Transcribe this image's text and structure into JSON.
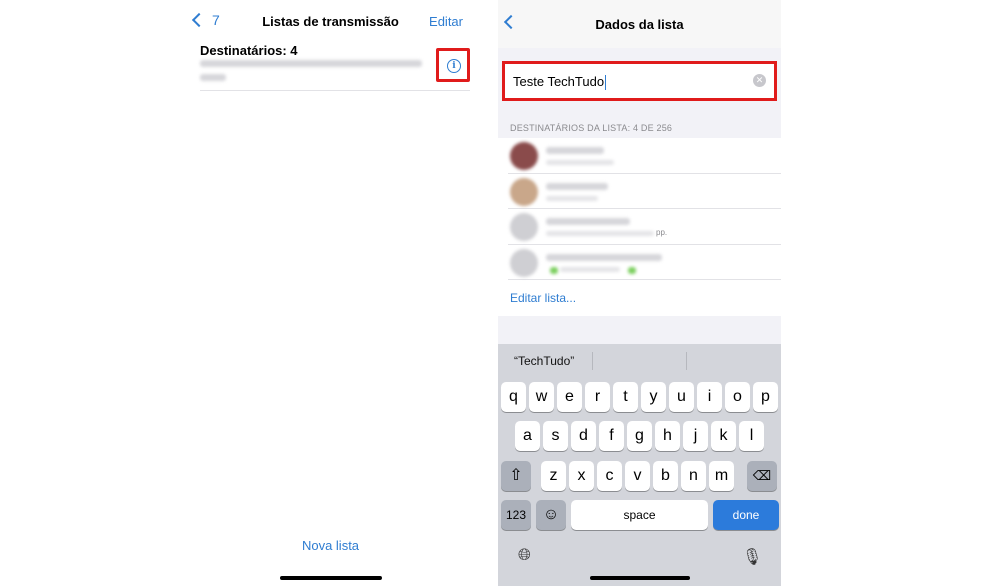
{
  "left": {
    "back_label": "7",
    "title": "Listas de transmissão",
    "edit_label": "Editar",
    "list_title": "Destinatários: 4",
    "info_icon_glyph": "i",
    "new_list_label": "Nova lista"
  },
  "right": {
    "title": "Dados da lista",
    "list_name_value": "Teste TechTudo",
    "section_header": "DESTINATÁRIOS DA LISTA: 4 DE 256",
    "contact_suffix": "pp.",
    "edit_list_label": "Editar lista...",
    "suggestion": "“TechTudo”",
    "keyboard": {
      "row1": [
        "q",
        "w",
        "e",
        "r",
        "t",
        "y",
        "u",
        "i",
        "o",
        "p"
      ],
      "row2": [
        "a",
        "s",
        "d",
        "f",
        "g",
        "h",
        "j",
        "k",
        "l"
      ],
      "row3": [
        "z",
        "x",
        "c",
        "v",
        "b",
        "n",
        "m"
      ],
      "numbers_label": "123",
      "space_label": "space",
      "done_label": "done"
    }
  },
  "colors": {
    "accent": "#2f7dd1",
    "highlight": "#e01b1b",
    "done_key": "#2c7bdb"
  }
}
